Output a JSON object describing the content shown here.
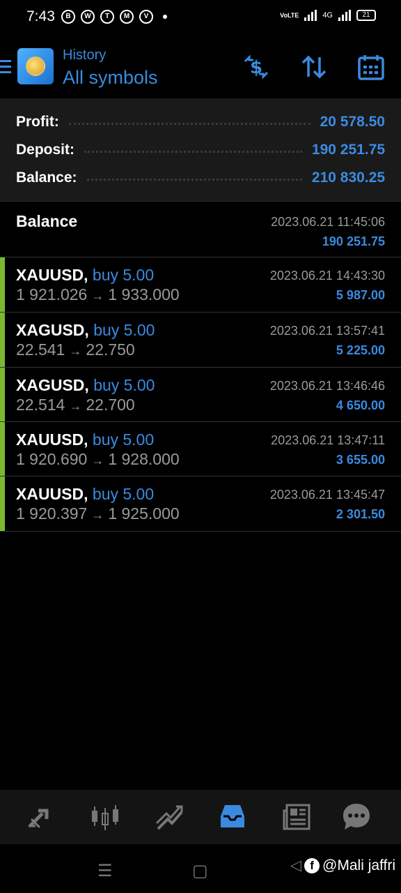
{
  "status": {
    "time": "7:43",
    "battery": "21",
    "network": "4G",
    "volte": "VoLTE",
    "app_icons": [
      "B",
      "W",
      "T",
      "M",
      "V"
    ]
  },
  "header": {
    "subtitle": "History",
    "title": "All symbols"
  },
  "summary": {
    "profit_label": "Profit:",
    "profit_value": "20 578.50",
    "deposit_label": "Deposit:",
    "deposit_value": "190 251.75",
    "balance_label": "Balance:",
    "balance_value": "210 830.25"
  },
  "balance_entry": {
    "title": "Balance",
    "time": "2023.06.21 11:45:06",
    "amount": "190 251.75"
  },
  "deals": [
    {
      "symbol": "XAUUSD,",
      "type": "buy 5.00",
      "open": "1 921.026",
      "arrow": "→",
      "close": "1 933.000",
      "time": "2023.06.21 14:43:30",
      "profit": "5 987.00"
    },
    {
      "symbol": "XAGUSD,",
      "type": "buy 5.00",
      "open": "22.541",
      "arrow": "→",
      "close": "22.750",
      "time": "2023.06.21 13:57:41",
      "profit": "5 225.00"
    },
    {
      "symbol": "XAGUSD,",
      "type": "buy 5.00",
      "open": "22.514",
      "arrow": "→",
      "close": "22.700",
      "time": "2023.06.21 13:46:46",
      "profit": "4 650.00"
    },
    {
      "symbol": "XAUUSD,",
      "type": "buy 5.00",
      "open": "1 920.690",
      "arrow": "→",
      "close": "1 928.000",
      "time": "2023.06.21 13:47:11",
      "profit": "3 655.00"
    },
    {
      "symbol": "XAUUSD,",
      "type": "buy 5.00",
      "open": "1 920.397",
      "arrow": "→",
      "close": "1 925.000",
      "time": "2023.06.21 13:45:47",
      "profit": "2 301.50"
    }
  ],
  "watermark": "@Mali jaffri",
  "colors": {
    "accent": "#3a8be0",
    "buy_bar": "#7cb82f",
    "muted": "#9a9a9a"
  }
}
